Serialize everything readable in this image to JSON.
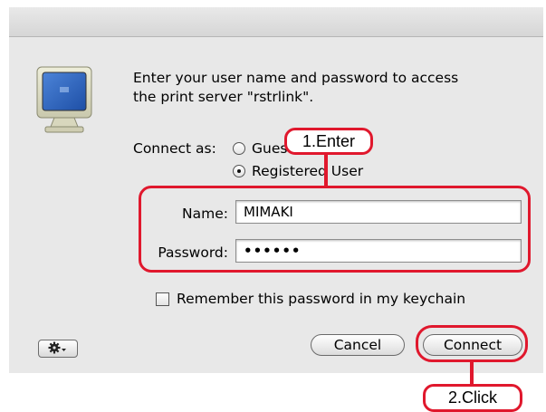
{
  "dialog": {
    "prompt": "Enter your user name and password to access\nthe print server \"rstrlink\".",
    "connect_as_label": "Connect as:",
    "radio_guest": "Guest",
    "radio_registered": "Registered User",
    "name_label": "Name:",
    "name_value": "MIMAKI",
    "password_label": "Password:",
    "password_value": "••••••",
    "remember_label": "Remember this password in my keychain",
    "cancel_label": "Cancel",
    "connect_label": "Connect"
  },
  "annotations": {
    "step1": "1.Enter",
    "step2": "2.Click"
  },
  "colors": {
    "annotation": "#e0182d",
    "dialog_bg": "#e8e8e8"
  },
  "icons": {
    "monitor": "monitor-icon",
    "gear": "gear-icon"
  }
}
